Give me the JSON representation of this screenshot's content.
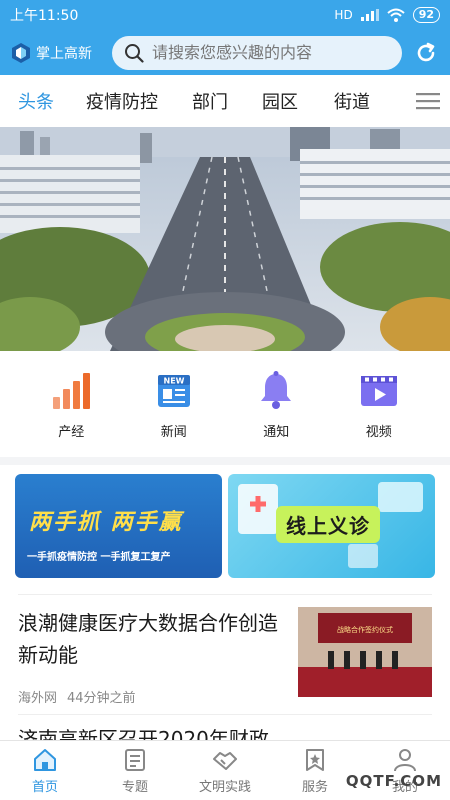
{
  "status_bar": {
    "time": "上午11:50",
    "battery": "92",
    "signal_label": "HD"
  },
  "header": {
    "logo_text": "掌上高新",
    "search_placeholder": "请搜索您感兴趣的内容"
  },
  "tabs": [
    {
      "label": "头条",
      "active": true
    },
    {
      "label": "疫情防控",
      "active": false
    },
    {
      "label": "部门",
      "active": false
    },
    {
      "label": "园区",
      "active": false
    },
    {
      "label": "街道",
      "active": false
    }
  ],
  "quick_nav": [
    {
      "label": "产经",
      "icon": "bar-chart-icon"
    },
    {
      "label": "新闻",
      "icon": "newspaper-icon"
    },
    {
      "label": "通知",
      "icon": "bell-icon"
    },
    {
      "label": "视频",
      "icon": "video-icon"
    }
  ],
  "promos": [
    {
      "title": "两手抓 两手赢",
      "subtitle": "一手抓疫情防控 一手抓复工复产"
    },
    {
      "title": "线上义诊"
    }
  ],
  "news": [
    {
      "title": "浪潮健康医疗大数据合作创造新动能",
      "source": "海外网",
      "time": "44分钟之前",
      "thumb_caption": "战略合作签约仪式"
    },
    {
      "title": "济南高新区召开2020年财政"
    }
  ],
  "bottom_nav": [
    {
      "label": "首页",
      "icon": "home-icon",
      "active": true
    },
    {
      "label": "专题",
      "icon": "topic-icon",
      "active": false
    },
    {
      "label": "文明实践",
      "icon": "handshake-icon",
      "active": false
    },
    {
      "label": "服务",
      "icon": "service-icon",
      "active": false
    },
    {
      "label": "我的",
      "icon": "user-icon",
      "active": false
    }
  ],
  "watermark": "QQTF.COM",
  "colors": {
    "brand_blue": "#3aa6ea",
    "active_blue": "#2f96e0",
    "orange": "#f07b3f",
    "purple": "#7b6ff0"
  }
}
